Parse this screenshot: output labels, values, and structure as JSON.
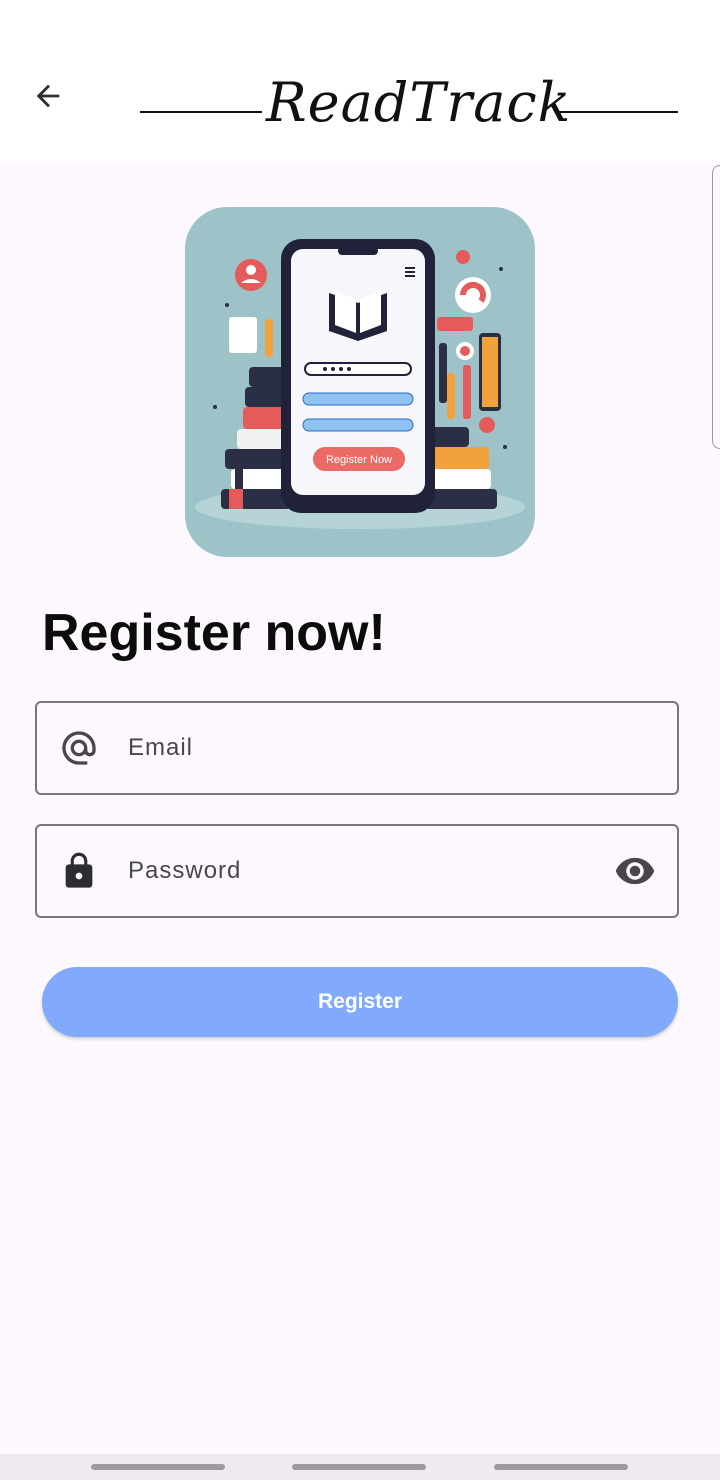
{
  "app": {
    "brand": "ReadTrack",
    "back_icon": "arrow-back-icon"
  },
  "hero": {
    "illustration": "phone-register-illustration",
    "button_text": "Register Now"
  },
  "form": {
    "title": "Register now!",
    "email": {
      "placeholder": "Email",
      "value": "",
      "icon": "at-sign-icon"
    },
    "password": {
      "placeholder": "Password",
      "value": "",
      "icon": "lock-icon",
      "toggle_icon": "eye-icon"
    },
    "submit_label": "Register"
  },
  "colors": {
    "accent": "#82aafc",
    "background": "#fdf8fd",
    "hero_bg": "#9dc3c8",
    "outline": "#79757f"
  }
}
